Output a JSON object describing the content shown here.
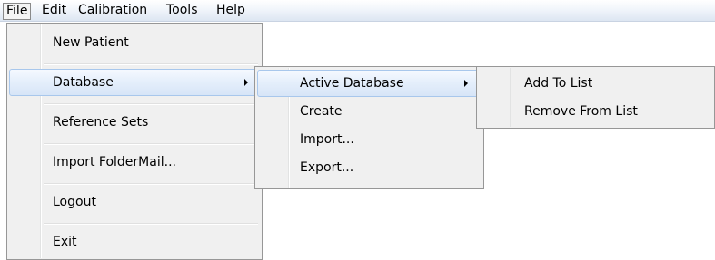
{
  "menubar": {
    "items": [
      {
        "label": "File"
      },
      {
        "label": "Edit"
      },
      {
        "label": "Calibration"
      },
      {
        "label": "Tools"
      },
      {
        "label": "Help"
      }
    ]
  },
  "file_menu": {
    "items": [
      {
        "label": "New Patient"
      },
      {
        "label": "Database"
      },
      {
        "label": "Reference Sets"
      },
      {
        "label": "Import FolderMail..."
      },
      {
        "label": "Logout"
      },
      {
        "label": "Exit"
      }
    ]
  },
  "database_menu": {
    "items": [
      {
        "label": "Active Database"
      },
      {
        "label": "Create"
      },
      {
        "label": "Import..."
      },
      {
        "label": "Export..."
      }
    ]
  },
  "active_database_menu": {
    "items": [
      {
        "label": "Add To List"
      },
      {
        "label": "Remove From List"
      }
    ]
  },
  "icons": {
    "submenu_arrow": "chevron-right-icon"
  },
  "colors": {
    "menu_background": "#f0f0f0",
    "highlight_border": "#a8c7ec",
    "menubar_gradient_end": "#dde6f2"
  }
}
